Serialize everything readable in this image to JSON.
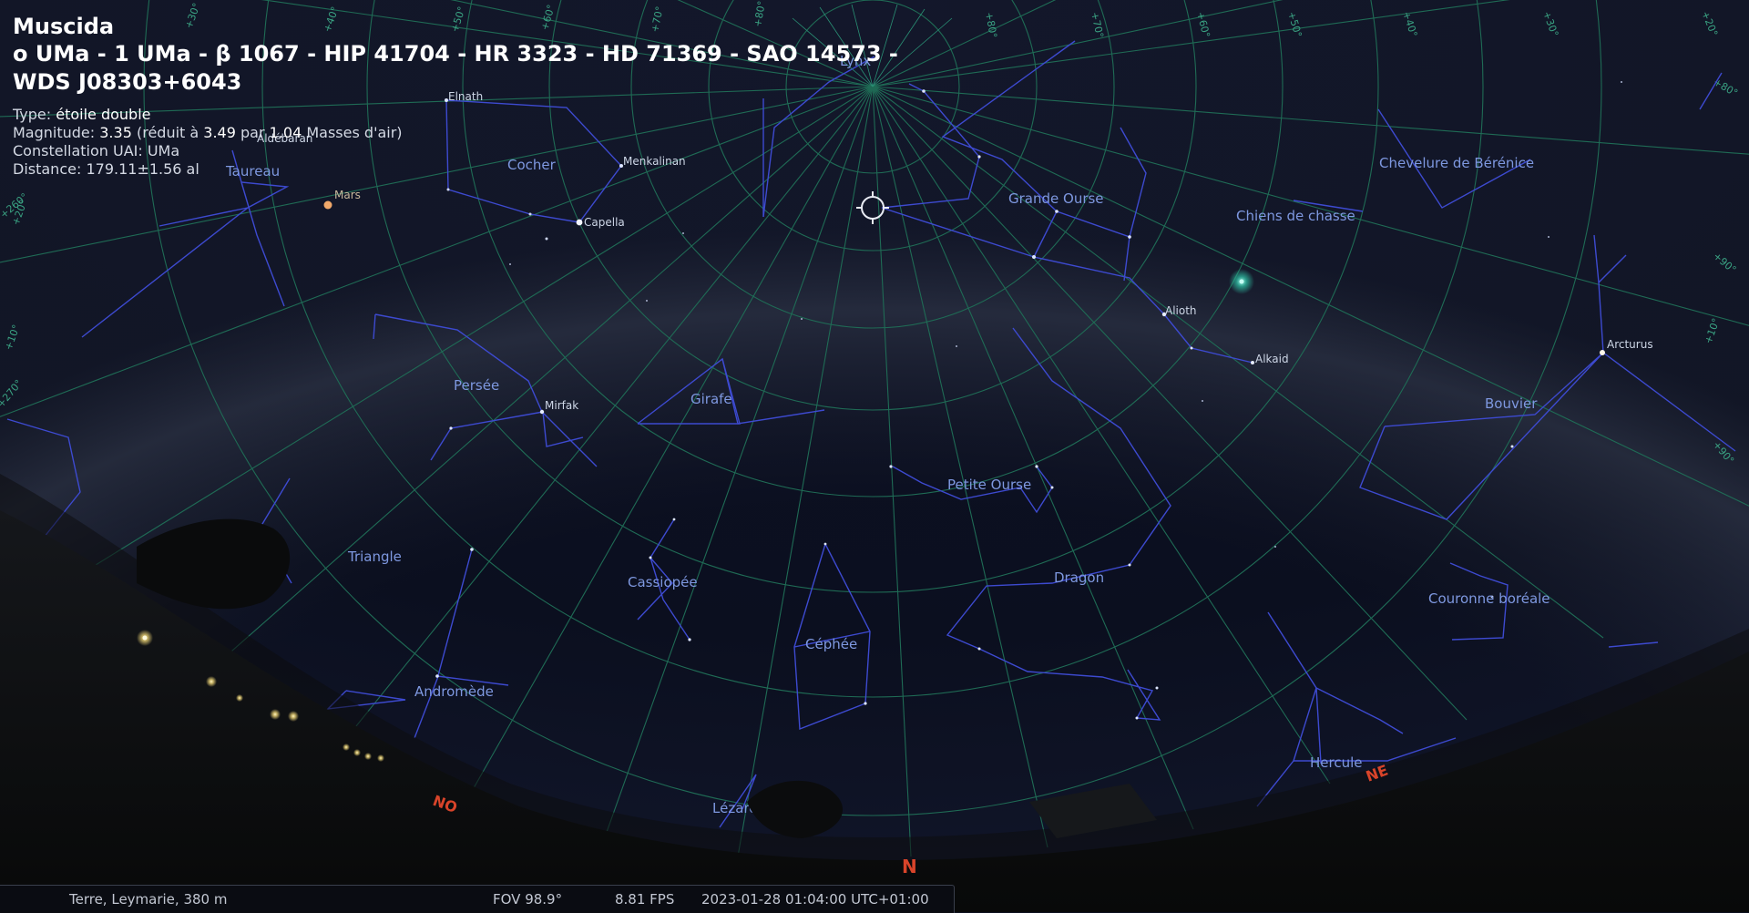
{
  "object": {
    "name": "Muscida",
    "identifiers_line1": "o UMa - 1 UMa - β 1067 - HIP 41704 - HR 3323 - HD 71369 - SAO 14573 -",
    "identifiers_line2": "WDS J08303+6043",
    "type_label": "Type:",
    "type_value": "étoile double",
    "magnitude_label": "Magnitude:",
    "magnitude_value": "3.35",
    "magnitude_extra_a": "(réduit à",
    "magnitude_reduced": "3.49",
    "magnitude_extra_b": "par",
    "airmass": "1.04",
    "magnitude_extra_c": "Masses d'air)",
    "constellation_label": "Constellation UAI:",
    "constellation_value": "UMa",
    "distance_label": "Distance:",
    "distance_value": "179.11±1.56 al"
  },
  "constellations": {
    "cocher": "Cocher",
    "taureau": "Taureau",
    "persee": "Persée",
    "girafe": "Girafe",
    "grande_ourse": "Grande Ourse",
    "chiens_chasse": "Chiens de chasse",
    "chevelure": "Chevelure de Bérénice",
    "bouvier": "Bouvier",
    "petite_ourse": "Petite Ourse",
    "dragon": "Dragon",
    "couronne": "Couronne boréale",
    "triangle": "Triangle",
    "cassiopee": "Cassiopée",
    "cephee": "Céphée",
    "andromede": "Andromède",
    "hercule": "Hercule",
    "lezard": "Lézard",
    "lynx": "Lynx"
  },
  "stars": {
    "elnath": "Elnath",
    "menkalinan": "Menkalinan",
    "capella": "Capella",
    "aldebaran": "Aldébaran",
    "mirfak": "Mirfak",
    "alioth": "Alioth",
    "alkaid": "Alkaid",
    "arcturus": "Arcturus"
  },
  "planets": {
    "mars": "Mars"
  },
  "cardinals": {
    "north": "N",
    "northwest": "NO",
    "northeast": "NE"
  },
  "grid_labels": {
    "alt_left_1": "+10°",
    "alt_left_2": "+20°",
    "az_left_1": "+260°",
    "az_left_2": "+270°",
    "alt_top_1": "+30°",
    "alt_top_2": "+40°",
    "alt_top_3": "+50°",
    "alt_top_4": "+60°",
    "alt_top_5": "+70°",
    "alt_top_6": "+80°",
    "alt_right_1": "+80°",
    "alt_right_2": "+70°",
    "alt_right_3": "+60°",
    "alt_right_4": "+50°",
    "alt_right_5": "+40°",
    "alt_right_6": "+30°",
    "alt_right_7": "+20°",
    "alt_right_8": "+10°",
    "az_right_1": "+90°",
    "az_right_2": "+80°",
    "az_right_3": "+90°"
  },
  "status": {
    "location": "Terre, Leymarie, 380 m",
    "fov": "FOV 98.9°",
    "fps": "8.81 FPS",
    "datetime": "2023-01-28 01:04:00 UTC+01:00"
  },
  "colors": {
    "sky": "#0b0f1e",
    "constellation_lines": "#3d4ad0",
    "grid": "#1f6b55",
    "labels": "#7e98e0",
    "cardinal": "#d8442a"
  }
}
